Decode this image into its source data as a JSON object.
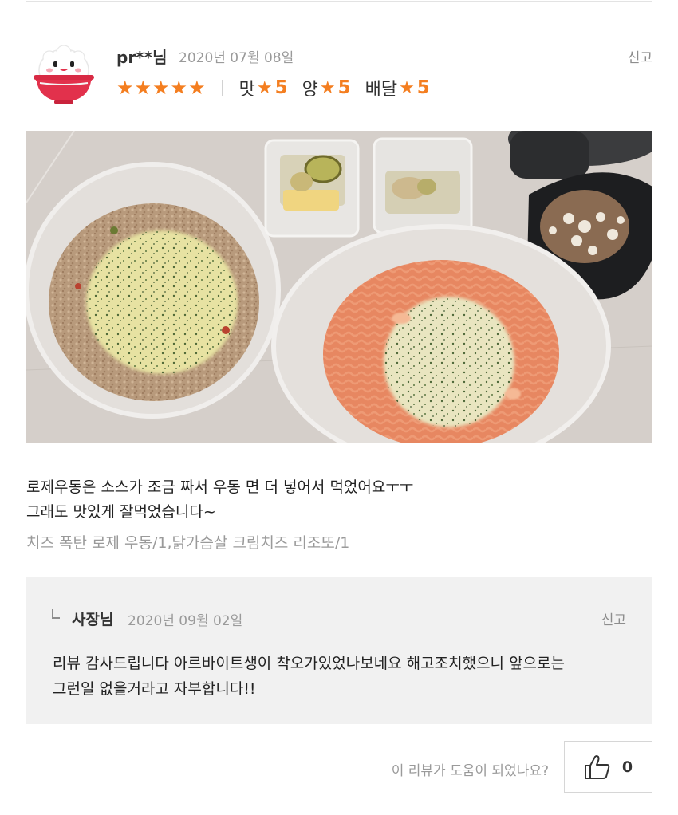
{
  "review": {
    "username": "pr**님",
    "date": "2020년 07월 08일",
    "report_label": "신고",
    "overall_stars": 5,
    "star_glyph": "★",
    "sub_ratings": [
      {
        "label": "맛",
        "value": "5"
      },
      {
        "label": "양",
        "value": "5"
      },
      {
        "label": "배달",
        "value": "5"
      }
    ],
    "text": "로제우동은 소스가 조금 짜서 우동 면 더 넣어서 먹었어요ㅜㅜ\n그래도 맛있게 잘먹었습니다~",
    "ordered_items": "치즈 폭탄 로제 우동/1,닭가슴살 크림치즈 리조또/1"
  },
  "owner_reply": {
    "name": "사장님",
    "date": "2020년 09월 02일",
    "report_label": "신고",
    "text": "리뷰 감사드립니다 아르바이트생이 착오가있었나보네요 해고조치했으니 앞으로는\n그런일 없을거라고 자부합니다!!"
  },
  "helpful": {
    "question": "이 리뷰가 도움이 되었나요?",
    "count": "0"
  },
  "colors": {
    "accent": "#f47e20",
    "reply_bg": "#f1f1f1",
    "muted_text": "#9a9a9a"
  },
  "icons": {
    "avatar": "rice-bowl-avatar-icon",
    "like": "thumbs-up-icon",
    "reply": "reply-arrow-icon"
  }
}
